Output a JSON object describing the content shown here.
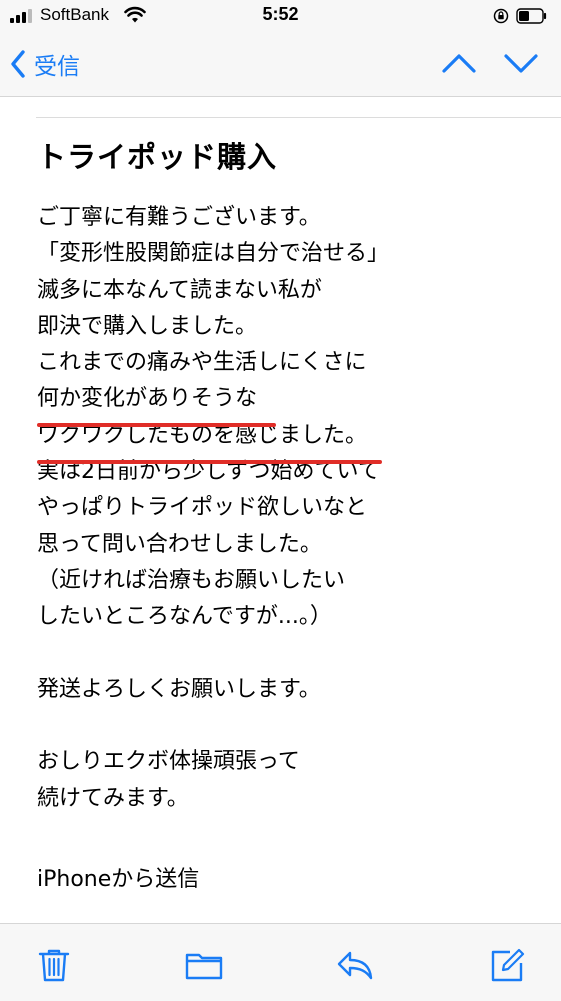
{
  "status_bar": {
    "carrier": "SoftBank",
    "time": "5:52",
    "signal_bars_filled": 3,
    "signal_bars_total": 4
  },
  "nav": {
    "back_label": "受信",
    "back_icon": "chevron-left-icon",
    "prev_icon": "chevron-up-icon",
    "next_icon": "chevron-down-icon"
  },
  "email": {
    "subject": "トライポッド購入",
    "body_lines": [
      "ご丁寧に有難うございます。",
      "「変形性股関節症は自分で治せる」",
      "滅多に本なんて読まない私が",
      "即決で購入しました。",
      "これまでの痛みや生活しにくさに",
      "何か変化がありそうな",
      "ワクワクしたものを感じました。",
      "実は2日前から少しずつ始めていて",
      "やっぱりトライポッド欲しいなと",
      "思って問い合わせしました。",
      "（近ければ治療もお願いしたい",
      "したいところなんですが...。）",
      "",
      "発送よろしくお願いします。",
      "",
      "おしりエクボ体操頑張って",
      "続けてみます。"
    ],
    "signature": "iPhoneから送信"
  },
  "toolbar": {
    "icons": [
      "trash-icon",
      "folder-icon",
      "reply-icon",
      "compose-icon"
    ]
  },
  "colors": {
    "accent": "#1a7cf5",
    "underline": "#e02d27",
    "bar_bg": "#f7f7f7"
  }
}
